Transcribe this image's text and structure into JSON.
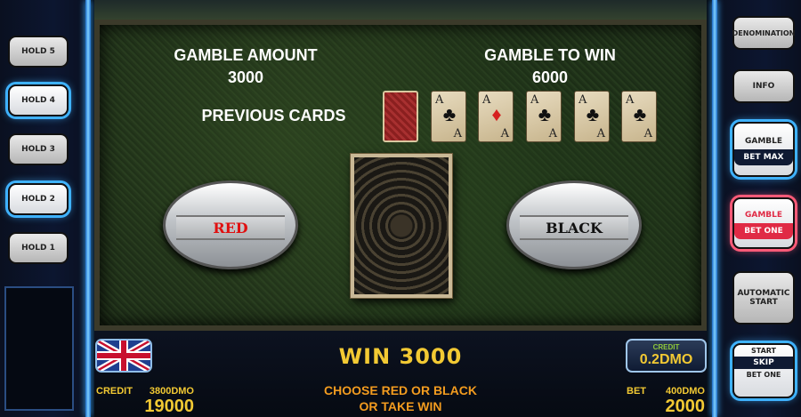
{
  "left_panel": {
    "holds": [
      "HOLD 5",
      "HOLD 4",
      "HOLD 3",
      "HOLD 2",
      "HOLD 1"
    ]
  },
  "right_panel": {
    "denomination": "DENOMINATION",
    "info": "INFO",
    "gamble_top": "GAMBLE",
    "bet_max": "BET MAX",
    "gamble_red_top": "GAMBLE",
    "bet_one": "BET ONE",
    "automatic": "AUTOMATIC",
    "start": "START",
    "start_top": "START",
    "skip": "SKIP",
    "bet_one_bottom": "BET ONE"
  },
  "table": {
    "gamble_amount_label": "GAMBLE AMOUNT",
    "gamble_amount_value": "3000",
    "gamble_to_win_label": "GAMBLE TO WIN",
    "gamble_to_win_value": "6000",
    "previous_cards_label": "PREVIOUS CARDS",
    "previous_cards": [
      {
        "type": "back"
      },
      {
        "rank": "A",
        "suit": "♣",
        "color": "#111111"
      },
      {
        "rank": "A",
        "suit": "♦",
        "color": "#d62020"
      },
      {
        "rank": "A",
        "suit": "♣",
        "color": "#111111"
      },
      {
        "rank": "A",
        "suit": "♣",
        "color": "#111111"
      },
      {
        "rank": "A",
        "suit": "♣",
        "color": "#111111"
      }
    ],
    "red_button": "RED",
    "black_button": "BLACK"
  },
  "bottom": {
    "win_text": "WIN 3000",
    "instruction_line1": "CHOOSE RED OR BLACK",
    "instruction_line2": "OR TAKE WIN",
    "credit_label": "CREDIT",
    "credit_dmo": "3800DMO",
    "credit_value": "19000",
    "bet_label": "BET",
    "bet_dmo": "400DMO",
    "bet_value": "2000",
    "denom_label": "CREDIT",
    "denom_value": "0.2DMO"
  },
  "colors": {
    "accent_blue": "#3fb2ff",
    "gold": "#f2c933",
    "red_button_text": "#e01010"
  }
}
